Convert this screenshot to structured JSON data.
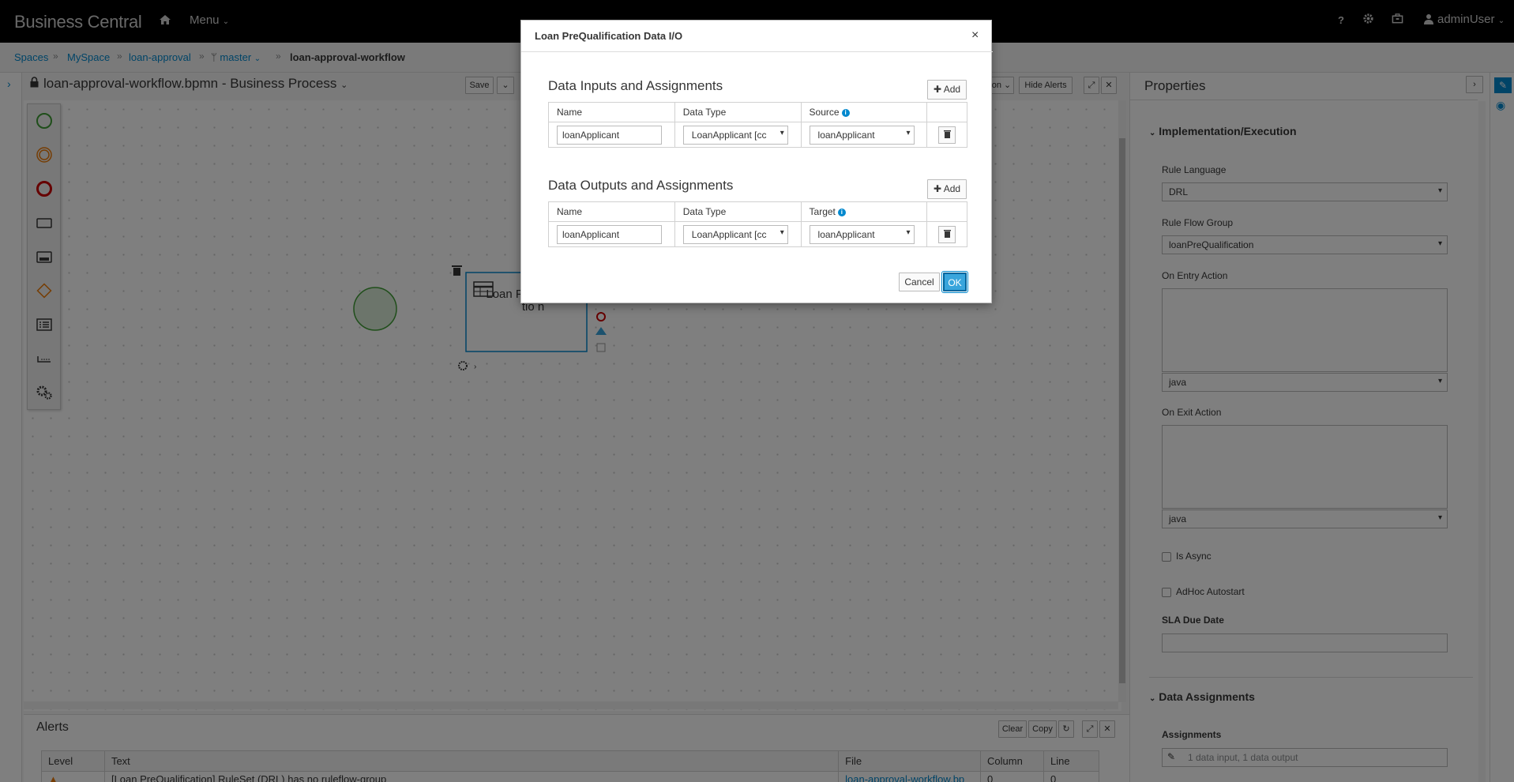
{
  "topnav": {
    "brand": "Business Central",
    "menu_label": "Menu",
    "help_label": "?",
    "user_label": "adminUser"
  },
  "breadcrumbs": [
    "Spaces",
    "MySpace",
    "loan-approval",
    "master",
    "loan-approval-workflow"
  ],
  "editor": {
    "title": "loan-approval-workflow.bpmn - Business Process",
    "save_label": "Save",
    "hide_alerts_label": "Hide Alerts",
    "partial_label": "on",
    "node_label": "Loan PreQualificatio n"
  },
  "alerts": {
    "title": "Alerts",
    "clear_label": "Clear",
    "copy_label": "Copy",
    "columns": [
      "Level",
      "Text",
      "File",
      "Column",
      "Line"
    ],
    "row": {
      "text": "[Loan PreQualification] RuleSet (DRL) has no ruleflow-group",
      "file": "loan-approval-workflow.bp",
      "column": "0",
      "line": "0"
    }
  },
  "properties": {
    "title": "Properties",
    "impl_section": "Implementation/Execution",
    "rule_language_label": "Rule Language",
    "rule_language_value": "DRL",
    "rule_flow_group_label": "Rule Flow Group",
    "rule_flow_group_value": "loanPreQualification",
    "on_entry_label": "On Entry Action",
    "on_entry_lang": "java",
    "on_exit_label": "On Exit Action",
    "on_exit_lang": "java",
    "is_async_label": "Is Async",
    "adhoc_label": "AdHoc Autostart",
    "sla_label": "SLA Due Date",
    "data_section": "Data Assignments",
    "assignments_label": "Assignments",
    "assignments_value": "1 data input, 1 data output"
  },
  "dialog": {
    "title": "Loan PreQualification Data I/O",
    "close_glyph": "×",
    "inputs_heading": "Data Inputs and Assignments",
    "outputs_heading": "Data Outputs and Assignments",
    "add_label": "Add",
    "col_name": "Name",
    "col_type": "Data Type",
    "col_source": "Source",
    "col_target": "Target",
    "input_row": {
      "name": "loanApplicant",
      "type": "LoanApplicant [cc",
      "source": "loanApplicant"
    },
    "output_row": {
      "name": "loanApplicant",
      "type": "LoanApplicant [cc",
      "target": "loanApplicant"
    },
    "cancel_label": "Cancel",
    "ok_label": "OK"
  },
  "colors": {
    "accent": "#0088ce",
    "topbar": "#000000",
    "ok_button": "#0088ce"
  },
  "icons": [
    "home-icon",
    "help-icon",
    "gear-icon",
    "briefcase-icon",
    "user-icon",
    "lock-icon",
    "trash-icon",
    "plus-icon",
    "info-icon",
    "close-icon",
    "eye-icon",
    "edit-icon"
  ]
}
